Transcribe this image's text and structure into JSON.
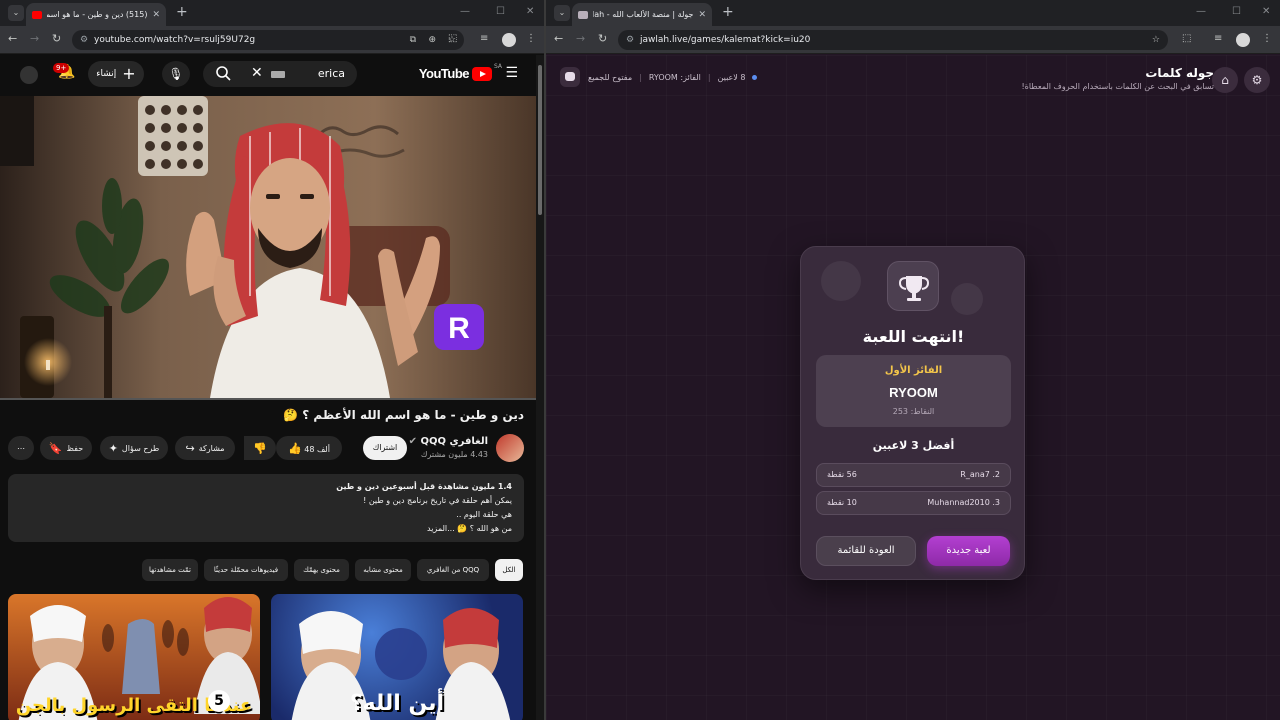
{
  "left_window": {
    "tab_title": "(515) دين و طين - ما هو اسم",
    "url": "youtube.com/watch?v=rsulj59U72g",
    "youtube": {
      "region": "SA",
      "logo": "YouTube",
      "search_value": "erica",
      "create_label": "إنشاء",
      "notification_count": "9+",
      "video_title": "دين و طين - ما هو اسم الله الأعظم ؟ 🤔",
      "channel_name": "الغافري QQQ",
      "subscribers": "4.43 مليون مشترك",
      "subscribe_label": "اشتراك",
      "likes": "48 ألف",
      "share_label": "مشاركة",
      "ask_label": "طرح سؤال",
      "save_label": "حفظ",
      "more_label": "⋯",
      "description": {
        "line1": "1.4 مليون مشاهدة  قبل أسبوعين  دين و طين",
        "line2": "يمكن أهم حلقة في تاريخ برنامج دين و طين !",
        "line3": "هي حلقة اليوم ..",
        "line4": "من هو الله ؟ 🤔 ...المزيد"
      },
      "chips": [
        "الكل",
        "من الغافري QQQ",
        "محتوى مشابه",
        "محتوى يهمّك",
        "فيديوهات محمّلة حديثًا",
        "تمّت مشاهدتها"
      ],
      "thumbnails": [
        {
          "caption": "أين الله؟"
        },
        {
          "caption": "عندما التقى الرسول بالجن"
        }
      ],
      "thumb_badge": "5",
      "video_progress": 0.0,
      "watermark": "R"
    }
  },
  "right_window": {
    "tab_title": "جولة | منصة الألعاب الله - Jawlah",
    "url": "jawlah.live/games/kalemat?kick=iu20",
    "game": {
      "title": "جوله كلمات",
      "subtitle": "تسابق في البحث عن الكلمات باستخدام الحروف المعطاة!",
      "players": "8 لاعبين",
      "winner_info": "الفائز: RYOOM",
      "open_label": "مفتوح للجميع",
      "card_title": "انتهت اللعبة!",
      "winner_label": "الفائز الأول",
      "winner_name": "RYOOM",
      "winner_points": "النقاط: 253",
      "top_label": "أفضل 3 لاعبين",
      "top_players": [
        {
          "name": "2. R_ana7",
          "points": "56 نقطة"
        },
        {
          "name": "3. Muhannad2010",
          "points": "10 نقطة"
        }
      ],
      "back_button": "العودة للقائمة",
      "new_game_button": "لعبة جديدة"
    }
  }
}
